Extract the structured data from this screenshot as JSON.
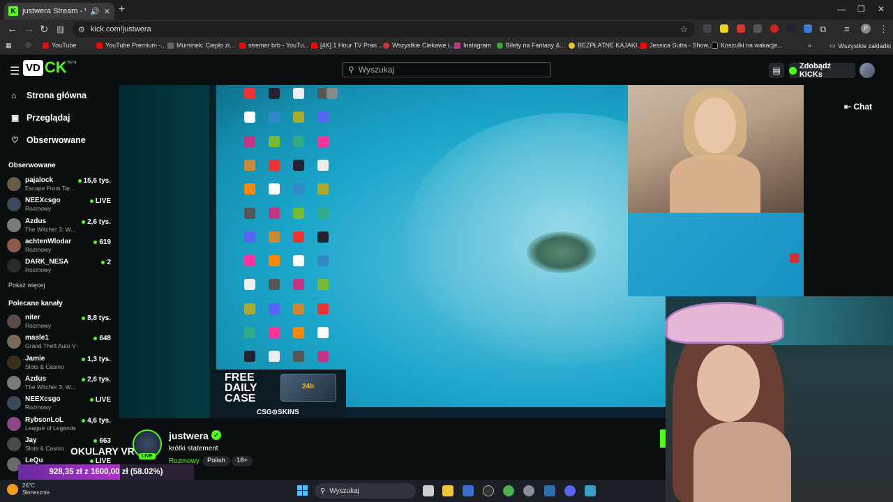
{
  "browser": {
    "tab_title": "justwera Stream - Watch Li",
    "new_tab": "+",
    "url": "kick.com/justwera",
    "bookmarks": [
      "YouTube",
      "YouTube Premium -...",
      "Muminek: Ciepło zi...",
      "stremer brb - YouTu...",
      "[4K] 1 Hour TV Pran...",
      "Wszystkie Ciekawe i...",
      "Instagram",
      "Bilety na Fantasy &...",
      "BEZPŁATNE KAJAKI...",
      "Jessica Sutta - Show...",
      "Koszulki na wakacje..."
    ],
    "all_bookmarks": "Wszystkie zakładki",
    "profile_initial": "P"
  },
  "header": {
    "logo_prefix": "VD",
    "logo_suffix": "CK",
    "logo_beta": "BETA",
    "search_placeholder": "Wyszukaj",
    "kicks_button": "Zdobądź KICKs"
  },
  "sidebar": {
    "nav": [
      {
        "label": "Strona główna",
        "icon": "home-icon"
      },
      {
        "label": "Przeglądaj",
        "icon": "browse-icon"
      },
      {
        "label": "Obserwowane",
        "icon": "heart-icon"
      }
    ],
    "followed_title": "Obserwowane",
    "followed": [
      {
        "name": "pajalock",
        "category": "Escape From Tar...",
        "viewers": "15,6 tys.",
        "color": "#6a5a4a"
      },
      {
        "name": "NEEXcsgo",
        "category": "Rozmowy",
        "viewers": "LIVE",
        "color": "#3a4a5a"
      },
      {
        "name": "Azdus",
        "category": "The Witcher 3: W...",
        "viewers": "2,6 tys.",
        "color": "#7a7a7a"
      },
      {
        "name": "achtenWlodar",
        "category": "Rozmowy",
        "viewers": "619",
        "color": "#8a5a4a"
      },
      {
        "name": "DARK_NESA",
        "category": "Rozmowy",
        "viewers": "2",
        "color": "#2a2a2a"
      }
    ],
    "show_more": "Pokaż więcej",
    "recommended_title": "Polecane kanały",
    "recommended": [
      {
        "name": "niter",
        "category": "Rozmowy",
        "viewers": "8,8 tys.",
        "color": "#5a4a4a"
      },
      {
        "name": "masle1",
        "category": "Grand Theft Auto V (G...",
        "viewers": "648",
        "color": "#7a6a5a"
      },
      {
        "name": "Jamie",
        "category": "Slots & Casino",
        "viewers": "1,3 tys.",
        "color": "#3a3020"
      },
      {
        "name": "Azdus",
        "category": "The Witcher 3: W...",
        "viewers": "2,6 tys.",
        "color": "#7a7a7a"
      },
      {
        "name": "NEEXcsgo",
        "category": "Rozmowy",
        "viewers": "LIVE",
        "color": "#3a4a5a"
      },
      {
        "name": "RybsonLoL",
        "category": "League of Legends",
        "viewers": "4,6 tys.",
        "color": "#8a4a8a"
      },
      {
        "name": "Jay",
        "category": "Slots & Casino",
        "viewers": "663",
        "color": "#4a4a4a"
      },
      {
        "name": "LeQu",
        "category": "",
        "viewers": "LIVE",
        "color": "#6a6a6a"
      }
    ]
  },
  "player": {
    "promo_line1": "FREE",
    "promo_line2": "DAILY",
    "promo_line3": "CASE",
    "promo_box": "24h",
    "promo_brand": "CSG⊙SKINS",
    "chat_button": "Chat"
  },
  "stream": {
    "streamer": "justwera",
    "title": "krótki statement",
    "category": "Rozmowy",
    "tags": [
      "Polish",
      "18+"
    ],
    "live_badge": "LIVE",
    "overlay_text": "OKULARY VR",
    "donation_text": "928,35 zł z 1600,00 zł (58.02%)",
    "donation_progress": 0.5802
  },
  "taskbar": {
    "temperature": "26°C",
    "weather": "Słonecznie",
    "search_placeholder": "Wyszukaj"
  },
  "colors": {
    "accent": "#53fc18",
    "background": "#0b0e0f"
  }
}
